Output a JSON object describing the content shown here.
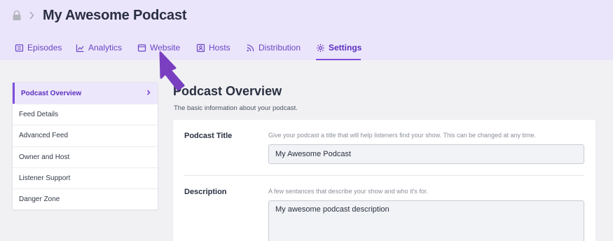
{
  "header": {
    "title": "My Awesome Podcast",
    "lock_icon": "lock-icon",
    "separator_icon": "chevron-right-icon"
  },
  "tabs": [
    {
      "label": "Episodes",
      "icon": "list-icon",
      "active": false
    },
    {
      "label": "Analytics",
      "icon": "chart-icon",
      "active": false
    },
    {
      "label": "Website",
      "icon": "browser-icon",
      "active": false
    },
    {
      "label": "Hosts",
      "icon": "user-card-icon",
      "active": false
    },
    {
      "label": "Distribution",
      "icon": "rss-icon",
      "active": false
    },
    {
      "label": "Settings",
      "icon": "gear-icon",
      "active": true
    }
  ],
  "sidebar": {
    "items": [
      {
        "label": "Podcast Overview",
        "active": true
      },
      {
        "label": "Feed Details",
        "active": false
      },
      {
        "label": "Advanced Feed",
        "active": false
      },
      {
        "label": "Owner and Host",
        "active": false
      },
      {
        "label": "Listener Support",
        "active": false
      },
      {
        "label": "Danger Zone",
        "active": false
      }
    ]
  },
  "content": {
    "title": "Podcast Overview",
    "subtitle": "The basic information about your podcast."
  },
  "form": {
    "podcast_title": {
      "label": "Podcast Title",
      "help": "Give your podcast a title that will help listeners find your show. This can be changed at any time.",
      "value": "My Awesome Podcast"
    },
    "description": {
      "label": "Description",
      "help": "A few sentances that describe your show and who it's for.",
      "value": "My awesome podcast description"
    }
  },
  "colors": {
    "accent": "#7c4ddb",
    "header_bg": "#ebe5fb",
    "arrow": "#7a3fc0"
  }
}
